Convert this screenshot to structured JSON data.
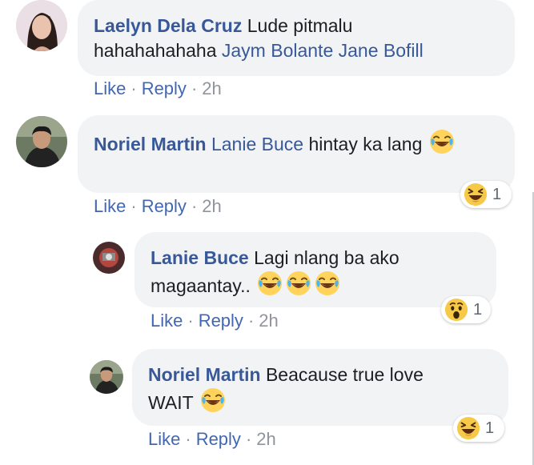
{
  "comments": [
    {
      "author": "Laelyn Dela Cruz",
      "text_before": "Lude pitmalu",
      "text_line2": "hahahahahaha",
      "mentions": [
        "Jaym Bolante",
        "Jane Bofill"
      ],
      "actions": {
        "like": "Like",
        "reply": "Reply",
        "time": "2h"
      }
    },
    {
      "author": "Noriel Martin",
      "mention": "Lanie Buce",
      "text": "hintay ka lang",
      "emoji": "joy-emoji",
      "reaction": {
        "emoji": "haha-reaction",
        "count": "1"
      },
      "actions": {
        "like": "Like",
        "reply": "Reply",
        "time": "2h"
      },
      "replies": [
        {
          "author": "Lanie Buce",
          "text_line1": "Lagi nlang ba ako",
          "text_line2": "magaantay..",
          "emoji_count": 3,
          "reaction": {
            "emoji": "wow-reaction",
            "count": "1"
          },
          "actions": {
            "like": "Like",
            "reply": "Reply",
            "time": "2h"
          }
        },
        {
          "author": "Noriel Martin",
          "text_line1": "Beacause true love",
          "text_line2": "WAIT",
          "emoji": "joy-emoji",
          "reaction": {
            "emoji": "haha-reaction",
            "count": "1"
          },
          "actions": {
            "like": "Like",
            "reply": "Reply",
            "time": "2h"
          }
        }
      ]
    }
  ],
  "separator": "·"
}
